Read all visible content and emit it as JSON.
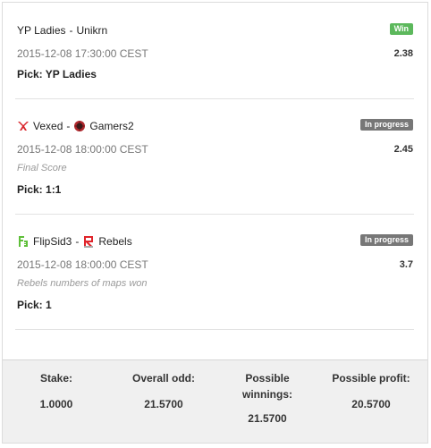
{
  "bets": [
    {
      "team1": "YP Ladies",
      "team2": "Unikrn",
      "team1_icon": "none",
      "team2_icon": "none",
      "status": "Win",
      "datetime": "2015-12-08 17:30:00 CEST",
      "odd": "2.38",
      "market": "",
      "pick": "Pick: YP Ladies"
    },
    {
      "team1": "Vexed",
      "team2": "Gamers2",
      "team1_icon": "vexed-logo-icon",
      "team2_icon": "gamers2-logo-icon",
      "status": "In progress",
      "datetime": "2015-12-08 18:00:00 CEST",
      "odd": "2.45",
      "market": "Final Score",
      "pick": "Pick: 1:1"
    },
    {
      "team1": "FlipSid3",
      "team2": "Rebels",
      "team1_icon": "flipsid3-logo-icon",
      "team2_icon": "rebels-logo-icon",
      "status": "In progress",
      "datetime": "2015-12-08 18:00:00 CEST",
      "odd": "3.7",
      "market": "Rebels numbers of maps won",
      "pick": "Pick: 1"
    }
  ],
  "separator": "-",
  "summary": {
    "stake_label": "Stake:",
    "stake_value": "1.0000",
    "overall_odd_label": "Overall odd:",
    "overall_odd_value": "21.5700",
    "possible_winnings_label_line1": "Possible",
    "possible_winnings_label_line2": "winnings:",
    "possible_winnings_value": "21.5700",
    "possible_profit_label": "Possible profit:",
    "possible_profit_value": "20.5700"
  },
  "colors": {
    "win": "#5cb85c",
    "in_progress": "#777777",
    "summary_bg": "#f0f0f0",
    "vexed_red": "#d9262c",
    "gamers2_red": "#b0282d",
    "flipsid3_green": "#5fbf3a",
    "rebels_red": "#e0252b"
  }
}
